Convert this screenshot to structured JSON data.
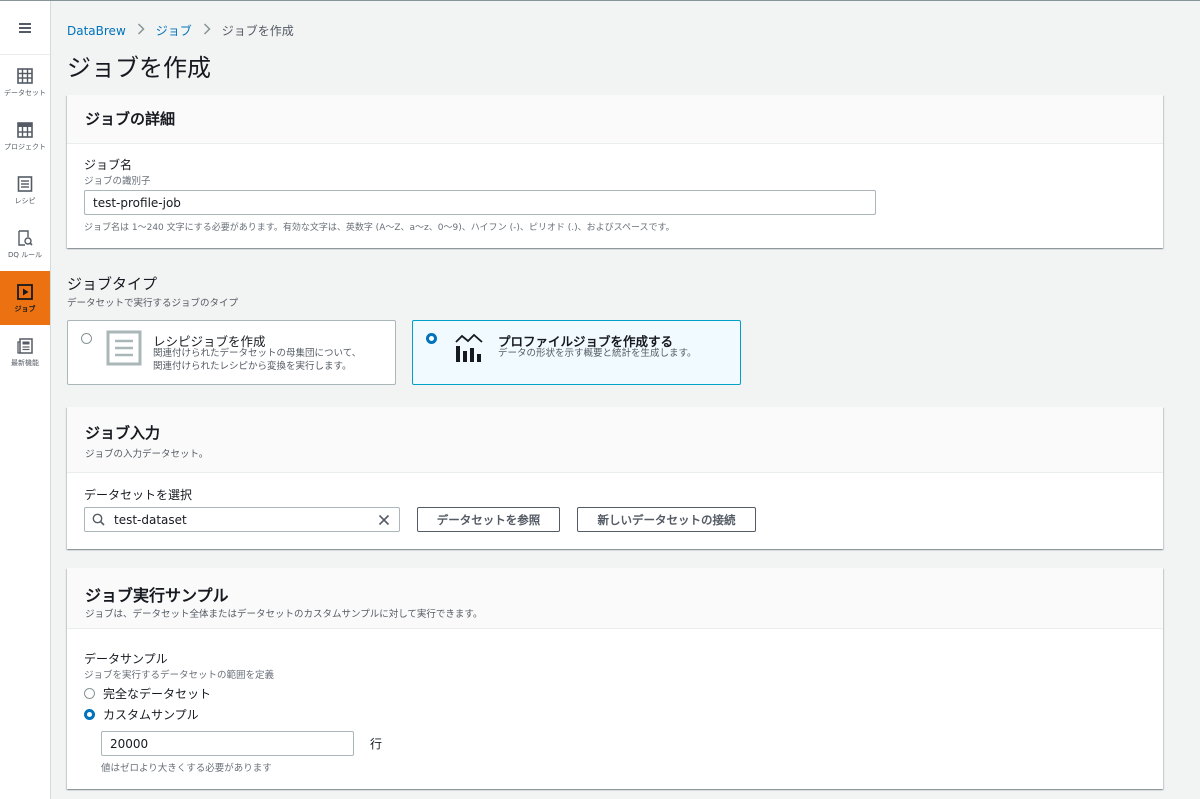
{
  "sidebar": {
    "menu_icon": "hamburger-icon",
    "items": [
      {
        "label": "データセット",
        "icon": "table-grid-icon",
        "active": false
      },
      {
        "label": "プロジェクト",
        "icon": "project-grid-icon",
        "active": false
      },
      {
        "label": "レシピ",
        "icon": "list-document-icon",
        "active": false
      },
      {
        "label": "DQ ルール",
        "icon": "document-search-icon",
        "active": false
      },
      {
        "label": "ジョブ",
        "icon": "play-box-icon",
        "active": true
      },
      {
        "label": "最新機能",
        "icon": "newspaper-icon",
        "active": false
      }
    ]
  },
  "breadcrumb": {
    "items": [
      "DataBrew",
      "ジョブ",
      "ジョブを作成"
    ]
  },
  "page_title": "ジョブを作成",
  "job_details": {
    "title": "ジョブの詳細",
    "name_label": "ジョブ名",
    "name_desc": "ジョブの識別子",
    "name_value": "test-profile-job",
    "name_constraint": "ジョブ名は 1～240 文字にする必要があります。有効な文字は、英数字 (A～Z、a～z、0～9)、ハイフン (-)、ピリオド (.)、およびスペースです。"
  },
  "job_type": {
    "title": "ジョブタイプ",
    "desc": "データセットで実行するジョブのタイプ",
    "options": [
      {
        "title": "レシピジョブを作成",
        "desc_lines": [
          "関連付けられたデータセットの母集団について、",
          "関連付けられたレシピから変換を実行します。"
        ],
        "selected": false
      },
      {
        "title": "プロファイルジョブを作成する",
        "desc_lines": [
          "データの形状を示す概要と統計を生成します。"
        ],
        "selected": true
      }
    ]
  },
  "job_input": {
    "title": "ジョブ入力",
    "desc": "ジョブの入力データセット。",
    "dataset_label": "データセットを選択",
    "dataset_value": "test-dataset",
    "browse_button": "データセットを参照",
    "connect_button": "新しいデータセットの接続"
  },
  "job_sample": {
    "title": "ジョブ実行サンプル",
    "desc": "ジョブは、データセット全体またはデータセットのカスタムサンプルに対して実行できます。",
    "sample_label": "データサンプル",
    "sample_desc": "ジョブを実行するデータセットの範囲を定義",
    "options": [
      {
        "label": "完全なデータセット",
        "selected": false
      },
      {
        "label": "カスタムサンプル",
        "selected": true
      }
    ],
    "row_count": "20000",
    "row_unit": "行",
    "row_constraint": "値はゼロより大きくする必要があります"
  },
  "colors": {
    "accent": "#ec7211",
    "link": "#0073bb",
    "selected_border": "#00a1c9",
    "selected_bg": "#f1faff"
  }
}
